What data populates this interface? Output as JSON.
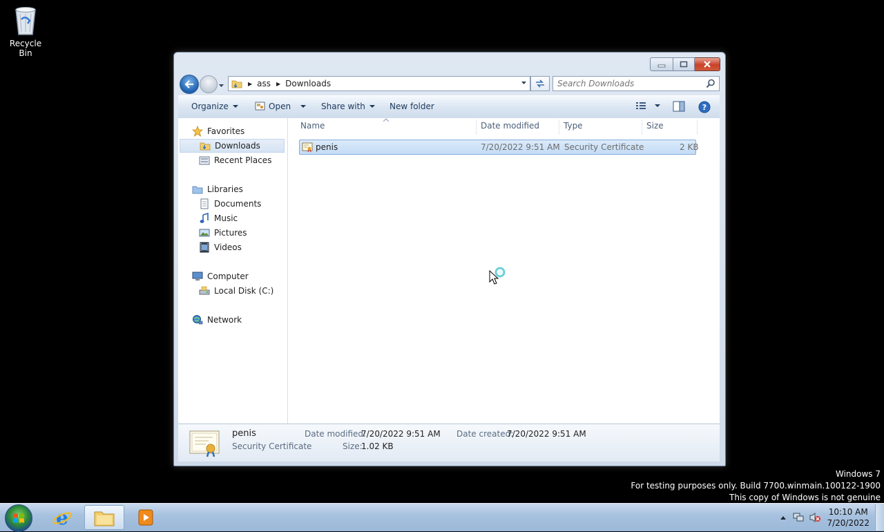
{
  "desktop": {
    "recycle_bin_label": "Recycle Bin",
    "watermark": {
      "line1": "Windows 7",
      "line2": "For testing purposes only. Build 7700.winmain.100122-1900",
      "line3": "This copy of Windows is not genuine"
    }
  },
  "window": {
    "breadcrumb": [
      "ass",
      "Downloads"
    ],
    "search_placeholder": "Search Downloads",
    "toolbar": {
      "organize": "Organize",
      "open": "Open",
      "share_with": "Share with",
      "new_folder": "New folder"
    },
    "nav": {
      "favorites": "Favorites",
      "downloads": "Downloads",
      "recent_places": "Recent Places",
      "libraries": "Libraries",
      "documents": "Documents",
      "music": "Music",
      "pictures": "Pictures",
      "videos": "Videos",
      "computer": "Computer",
      "local_disk": "Local Disk (C:)",
      "network": "Network"
    },
    "columns": {
      "name": "Name",
      "date_modified": "Date modified",
      "type": "Type",
      "size": "Size"
    },
    "files": [
      {
        "name": "penis",
        "date_modified": "7/20/2022 9:51 AM",
        "type": "Security Certificate",
        "size": "2 KB"
      }
    ],
    "details": {
      "name": "penis",
      "type": "Security Certificate",
      "date_modified_label": "Date modified:",
      "date_modified": "7/20/2022 9:51 AM",
      "date_created_label": "Date created:",
      "date_created": "7/20/2022 9:51 AM",
      "size_label": "Size:",
      "size": "1.02 KB"
    }
  },
  "taskbar": {
    "time": "10:10 AM",
    "date": "7/20/2022"
  },
  "colors": {
    "selection": "#c4dcf6",
    "toolbar_text": "#1e395b",
    "close_button": "#c8412a"
  }
}
